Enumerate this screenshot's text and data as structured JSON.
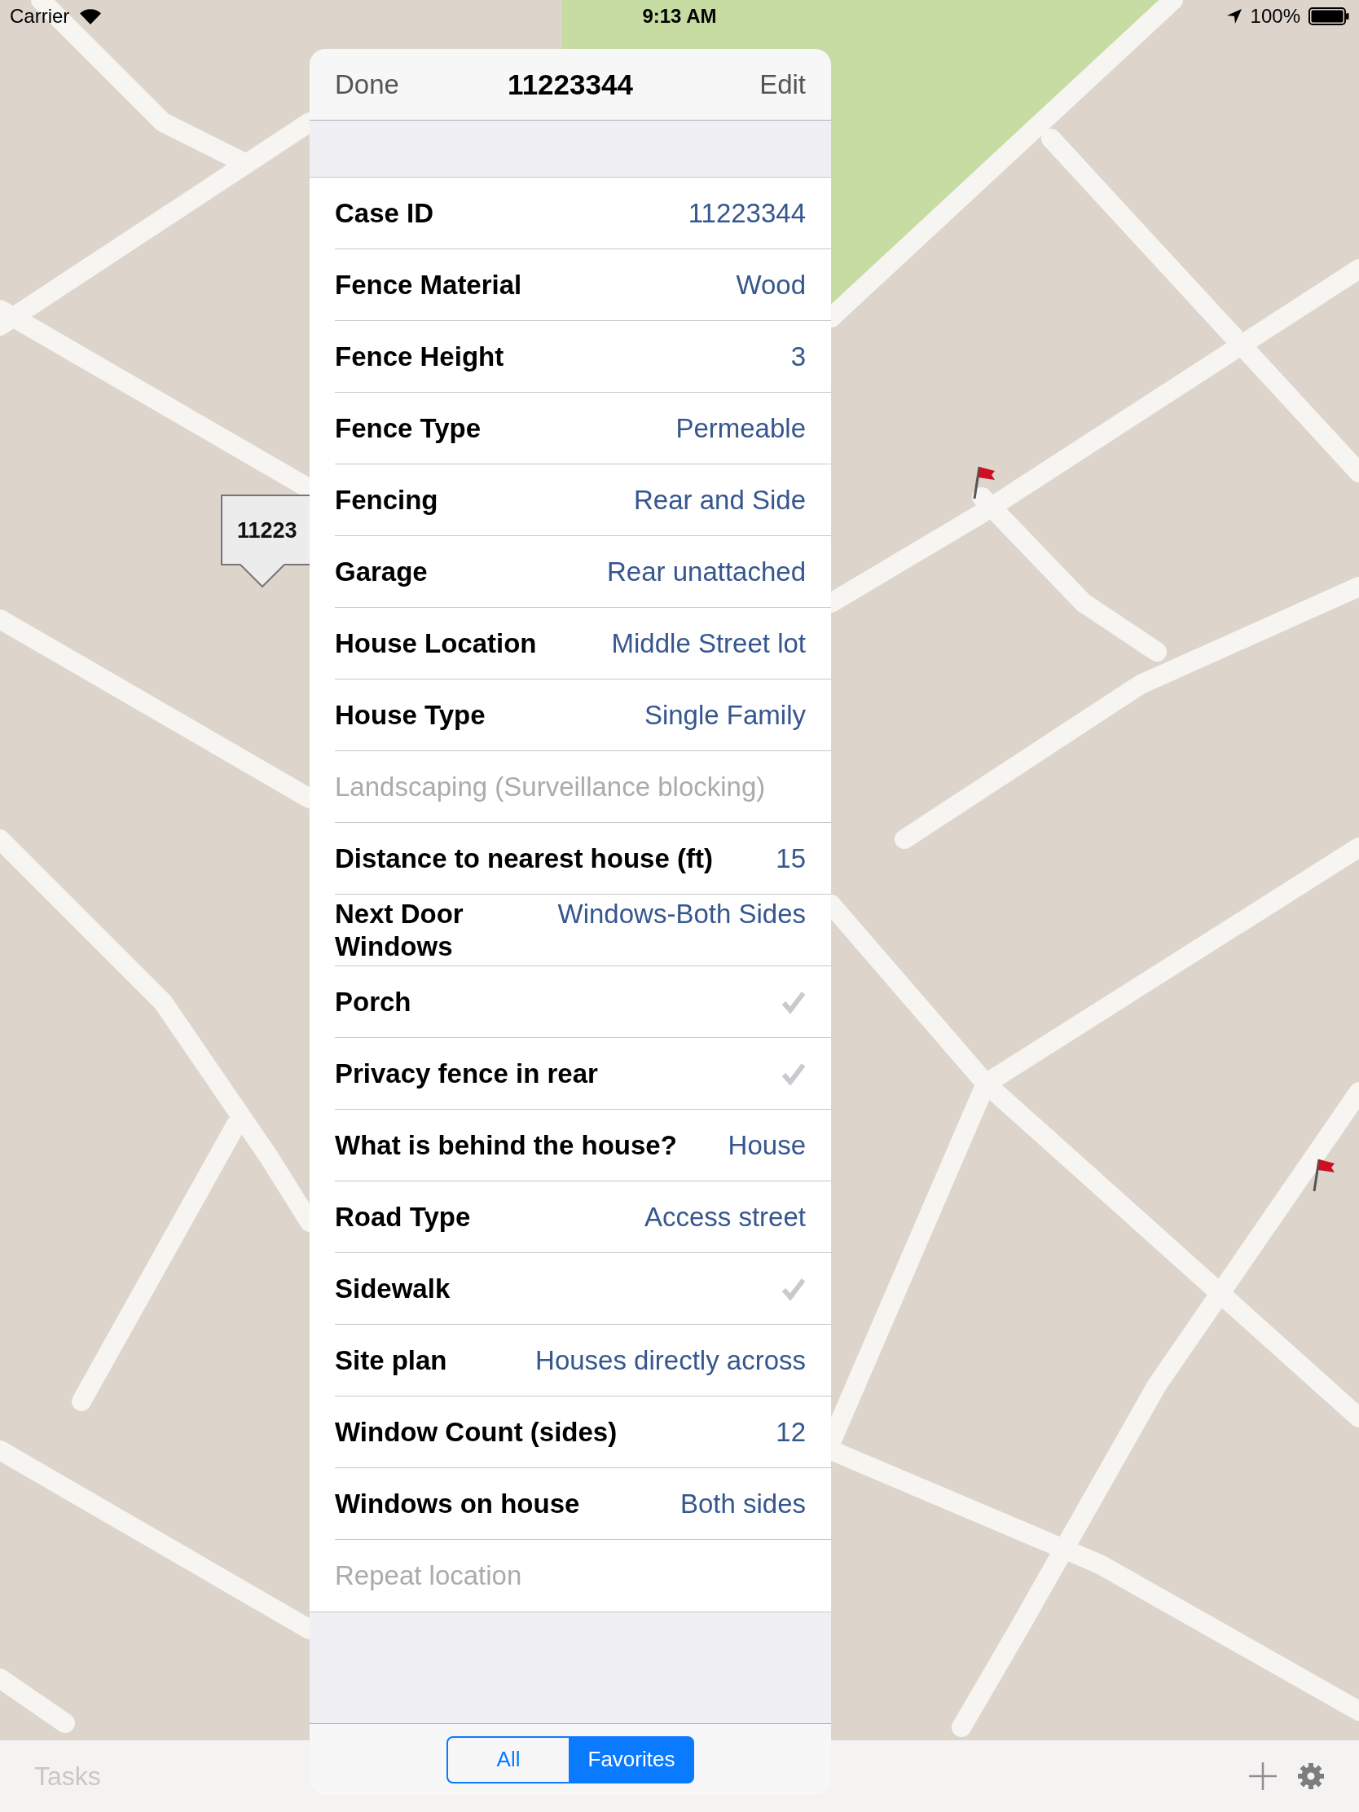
{
  "status_bar": {
    "carrier": "Carrier",
    "time": "9:13 AM",
    "battery": "100%"
  },
  "map": {
    "callout": "11223"
  },
  "panel": {
    "header": {
      "left_button": "Done",
      "title": "11223344",
      "right_button": "Edit"
    },
    "rows": [
      {
        "kind": "value",
        "label": "Case ID",
        "value": "11223344"
      },
      {
        "kind": "value",
        "label": "Fence Material",
        "value": "Wood"
      },
      {
        "kind": "value",
        "label": "Fence Height",
        "value": "3"
      },
      {
        "kind": "value",
        "label": "Fence Type",
        "value": "Permeable"
      },
      {
        "kind": "value",
        "label": "Fencing",
        "value": "Rear and Side"
      },
      {
        "kind": "value",
        "label": "Garage",
        "value": "Rear unattached"
      },
      {
        "kind": "value",
        "label": "House Location",
        "value": "Middle Street lot"
      },
      {
        "kind": "value",
        "label": "House Type",
        "value": "Single Family"
      },
      {
        "kind": "empty",
        "label": "Landscaping (Surveillance blocking)"
      },
      {
        "kind": "value",
        "label": "Distance to nearest house (ft)",
        "value": "15"
      },
      {
        "kind": "value",
        "label": "Next Door Windows",
        "value": "Windows-Both Sides"
      },
      {
        "kind": "check",
        "label": "Porch",
        "checked": true
      },
      {
        "kind": "check",
        "label": "Privacy fence in rear",
        "checked": true
      },
      {
        "kind": "value",
        "label": "What is behind the house?",
        "value": "House"
      },
      {
        "kind": "value",
        "label": "Road Type",
        "value": "Access street"
      },
      {
        "kind": "check",
        "label": "Sidewalk",
        "checked": true
      },
      {
        "kind": "value",
        "label": "Site plan",
        "value": "Houses directly across"
      },
      {
        "kind": "value",
        "label": "Window Count (sides)",
        "value": "12"
      },
      {
        "kind": "value",
        "label": "Windows on house",
        "value": "Both sides"
      },
      {
        "kind": "empty",
        "label": "Repeat location"
      }
    ],
    "segments": [
      {
        "label": "All",
        "selected": false
      },
      {
        "label": "Favorites",
        "selected": true
      }
    ]
  },
  "toolbar": {
    "tasks": {
      "label": "Tasks",
      "disabled": true
    }
  }
}
